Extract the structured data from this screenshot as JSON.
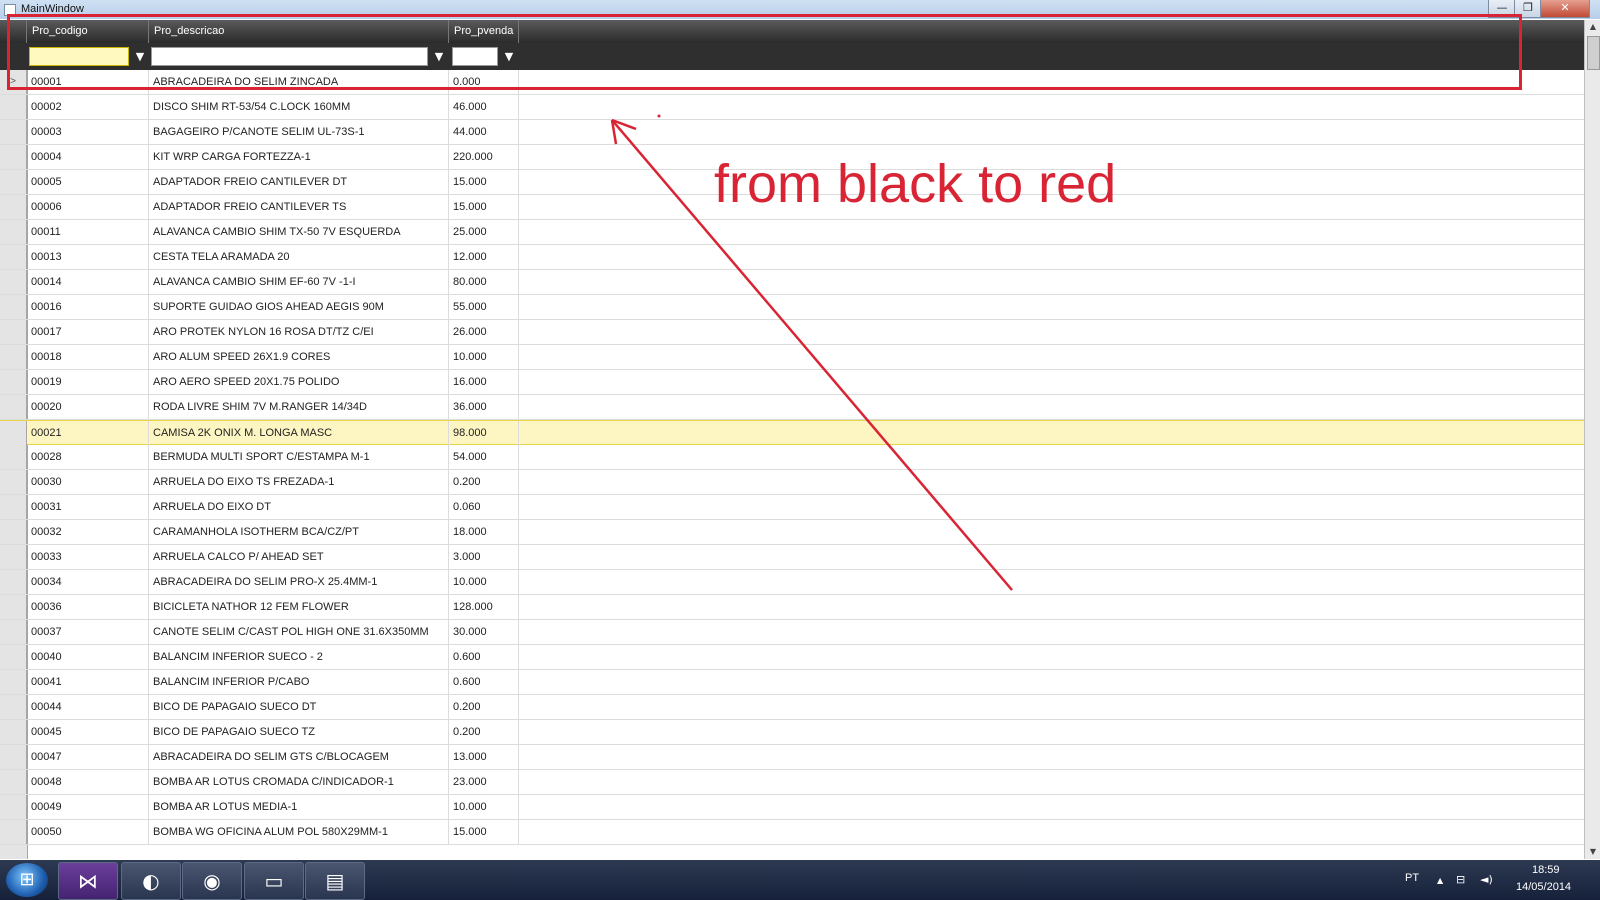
{
  "window": {
    "title": "MainWindow",
    "min_glyph": "—",
    "max_glyph": "❐",
    "close_glyph": "✕"
  },
  "grid": {
    "columns": [
      "Pro_codigo",
      "Pro_descricao",
      "Pro_pvenda"
    ],
    "filters": {
      "codigo": "",
      "descricao": "",
      "pvenda": ""
    },
    "filter_icon": "▼",
    "current_row_marker": ">",
    "rows": [
      [
        "00001",
        "ABRACADEIRA DO SELIM ZINCADA",
        "0.000"
      ],
      [
        "00002",
        "DISCO SHIM RT-53/54 C.LOCK 160MM",
        "46.000"
      ],
      [
        "00003",
        "BAGAGEIRO P/CANOTE SELIM UL-73S-1",
        "44.000"
      ],
      [
        "00004",
        "KIT WRP CARGA FORTEZZA-1",
        "220.000"
      ],
      [
        "00005",
        "ADAPTADOR FREIO CANTILEVER DT",
        "15.000"
      ],
      [
        "00006",
        "ADAPTADOR FREIO CANTILEVER TS",
        "15.000"
      ],
      [
        "00011",
        "ALAVANCA CAMBIO SHIM TX-50 7V ESQUERDA",
        "25.000"
      ],
      [
        "00013",
        "CESTA TELA ARAMADA 20",
        "12.000"
      ],
      [
        "00014",
        "ALAVANCA CAMBIO SHIM EF-60 7V -1-I",
        "80.000"
      ],
      [
        "00016",
        "SUPORTE GUIDAO GIOS AHEAD AEGIS 90M",
        "55.000"
      ],
      [
        "00017",
        "ARO PROTEK NYLON 16 ROSA DT/TZ C/EI",
        "26.000"
      ],
      [
        "00018",
        "ARO ALUM SPEED 26X1.9 CORES",
        "10.000"
      ],
      [
        "00019",
        "ARO AERO SPEED 20X1.75 POLIDO",
        "16.000"
      ],
      [
        "00020",
        "RODA LIVRE SHIM 7V M.RANGER  14/34D",
        "36.000"
      ],
      [
        "00021",
        "CAMISA 2K ONIX M. LONGA MASC",
        "98.000"
      ],
      [
        "00028",
        "BERMUDA MULTI SPORT C/ESTAMPA M-1",
        "54.000"
      ],
      [
        "00030",
        "ARRUELA DO EIXO TS FREZADA-1",
        "0.200"
      ],
      [
        "00031",
        "ARRUELA DO EIXO DT",
        "0.060"
      ],
      [
        "00032",
        "CARAMANHOLA ISOTHERM BCA/CZ/PT",
        "18.000"
      ],
      [
        "00033",
        "ARRUELA CALCO P/ AHEAD SET",
        "3.000"
      ],
      [
        "00034",
        "ABRACADEIRA DO SELIM PRO-X 25.4MM-1",
        "10.000"
      ],
      [
        "00036",
        "BICICLETA NATHOR 12 FEM FLOWER",
        "128.000"
      ],
      [
        "00037",
        "CANOTE SELIM C/CAST POL HIGH ONE 31.6X350MM",
        "30.000"
      ],
      [
        "00040",
        "BALANCIM INFERIOR SUECO - 2",
        "0.600"
      ],
      [
        "00041",
        "BALANCIM INFERIOR P/CABO",
        "0.600"
      ],
      [
        "00044",
        "BICO DE PAPAGAIO SUECO DT",
        "0.200"
      ],
      [
        "00045",
        "BICO DE PAPAGAIO SUECO TZ",
        "0.200"
      ],
      [
        "00047",
        "ABRACADEIRA DO SELIM GTS C/BLOCAGEM",
        "13.000"
      ],
      [
        "00048",
        "BOMBA AR LOTUS CROMADA C/INDICADOR-1",
        "23.000"
      ],
      [
        "00049",
        "BOMBA AR LOTUS MEDIA-1",
        "10.000"
      ],
      [
        "00050",
        "BOMBA WG OFICINA ALUM POL 580X29MM-1",
        "15.000"
      ]
    ],
    "selected_row_code": "00021"
  },
  "annotation": {
    "text_part1": "from black to",
    "text_part2": "red",
    "color": "#d82434"
  },
  "colors": {
    "header_bg": "#2b2b2b",
    "selected_row_bg": "#fdf6c3"
  },
  "taskbar": {
    "language": "PT",
    "time": "18:59",
    "date": "14/05/2014",
    "up_arrow": "▲",
    "icons": [
      "windows-start-icon",
      "visual-studio-icon",
      "app-swirl-icon",
      "firefox-icon",
      "file-explorer-icon",
      "notepad-icon"
    ]
  }
}
